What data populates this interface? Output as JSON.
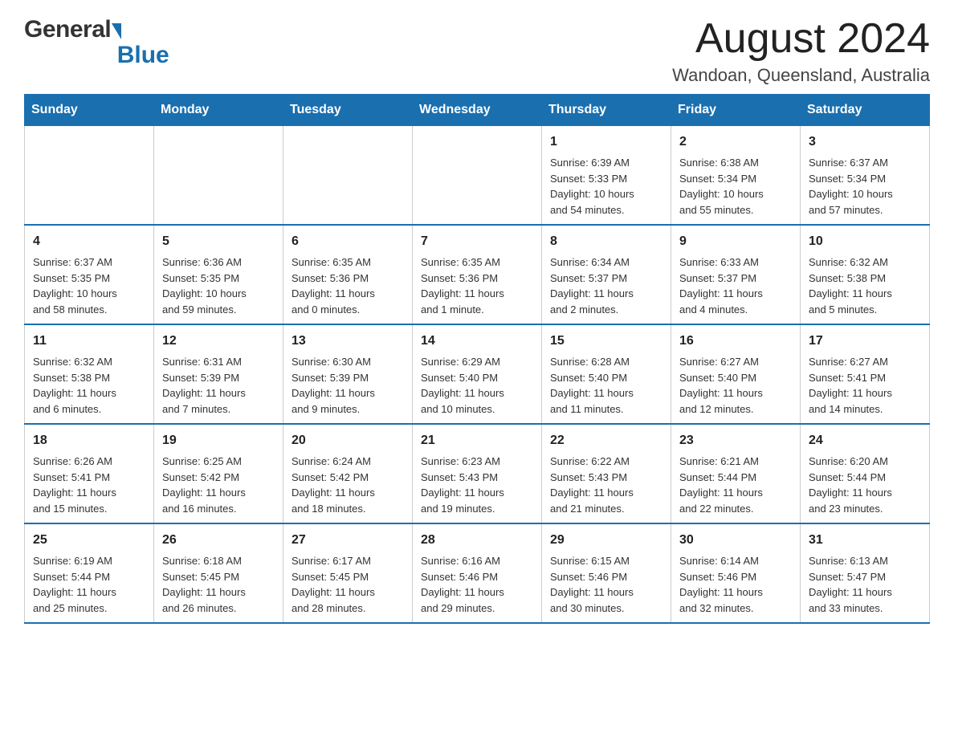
{
  "header": {
    "logo_general": "General",
    "logo_arrow": "▶",
    "logo_blue": "Blue",
    "month_title": "August 2024",
    "location": "Wandoan, Queensland, Australia"
  },
  "days_of_week": [
    "Sunday",
    "Monday",
    "Tuesday",
    "Wednesday",
    "Thursday",
    "Friday",
    "Saturday"
  ],
  "weeks": [
    {
      "days": [
        {
          "number": "",
          "info": ""
        },
        {
          "number": "",
          "info": ""
        },
        {
          "number": "",
          "info": ""
        },
        {
          "number": "",
          "info": ""
        },
        {
          "number": "1",
          "info": "Sunrise: 6:39 AM\nSunset: 5:33 PM\nDaylight: 10 hours\nand 54 minutes."
        },
        {
          "number": "2",
          "info": "Sunrise: 6:38 AM\nSunset: 5:34 PM\nDaylight: 10 hours\nand 55 minutes."
        },
        {
          "number": "3",
          "info": "Sunrise: 6:37 AM\nSunset: 5:34 PM\nDaylight: 10 hours\nand 57 minutes."
        }
      ]
    },
    {
      "days": [
        {
          "number": "4",
          "info": "Sunrise: 6:37 AM\nSunset: 5:35 PM\nDaylight: 10 hours\nand 58 minutes."
        },
        {
          "number": "5",
          "info": "Sunrise: 6:36 AM\nSunset: 5:35 PM\nDaylight: 10 hours\nand 59 minutes."
        },
        {
          "number": "6",
          "info": "Sunrise: 6:35 AM\nSunset: 5:36 PM\nDaylight: 11 hours\nand 0 minutes."
        },
        {
          "number": "7",
          "info": "Sunrise: 6:35 AM\nSunset: 5:36 PM\nDaylight: 11 hours\nand 1 minute."
        },
        {
          "number": "8",
          "info": "Sunrise: 6:34 AM\nSunset: 5:37 PM\nDaylight: 11 hours\nand 2 minutes."
        },
        {
          "number": "9",
          "info": "Sunrise: 6:33 AM\nSunset: 5:37 PM\nDaylight: 11 hours\nand 4 minutes."
        },
        {
          "number": "10",
          "info": "Sunrise: 6:32 AM\nSunset: 5:38 PM\nDaylight: 11 hours\nand 5 minutes."
        }
      ]
    },
    {
      "days": [
        {
          "number": "11",
          "info": "Sunrise: 6:32 AM\nSunset: 5:38 PM\nDaylight: 11 hours\nand 6 minutes."
        },
        {
          "number": "12",
          "info": "Sunrise: 6:31 AM\nSunset: 5:39 PM\nDaylight: 11 hours\nand 7 minutes."
        },
        {
          "number": "13",
          "info": "Sunrise: 6:30 AM\nSunset: 5:39 PM\nDaylight: 11 hours\nand 9 minutes."
        },
        {
          "number": "14",
          "info": "Sunrise: 6:29 AM\nSunset: 5:40 PM\nDaylight: 11 hours\nand 10 minutes."
        },
        {
          "number": "15",
          "info": "Sunrise: 6:28 AM\nSunset: 5:40 PM\nDaylight: 11 hours\nand 11 minutes."
        },
        {
          "number": "16",
          "info": "Sunrise: 6:27 AM\nSunset: 5:40 PM\nDaylight: 11 hours\nand 12 minutes."
        },
        {
          "number": "17",
          "info": "Sunrise: 6:27 AM\nSunset: 5:41 PM\nDaylight: 11 hours\nand 14 minutes."
        }
      ]
    },
    {
      "days": [
        {
          "number": "18",
          "info": "Sunrise: 6:26 AM\nSunset: 5:41 PM\nDaylight: 11 hours\nand 15 minutes."
        },
        {
          "number": "19",
          "info": "Sunrise: 6:25 AM\nSunset: 5:42 PM\nDaylight: 11 hours\nand 16 minutes."
        },
        {
          "number": "20",
          "info": "Sunrise: 6:24 AM\nSunset: 5:42 PM\nDaylight: 11 hours\nand 18 minutes."
        },
        {
          "number": "21",
          "info": "Sunrise: 6:23 AM\nSunset: 5:43 PM\nDaylight: 11 hours\nand 19 minutes."
        },
        {
          "number": "22",
          "info": "Sunrise: 6:22 AM\nSunset: 5:43 PM\nDaylight: 11 hours\nand 21 minutes."
        },
        {
          "number": "23",
          "info": "Sunrise: 6:21 AM\nSunset: 5:44 PM\nDaylight: 11 hours\nand 22 minutes."
        },
        {
          "number": "24",
          "info": "Sunrise: 6:20 AM\nSunset: 5:44 PM\nDaylight: 11 hours\nand 23 minutes."
        }
      ]
    },
    {
      "days": [
        {
          "number": "25",
          "info": "Sunrise: 6:19 AM\nSunset: 5:44 PM\nDaylight: 11 hours\nand 25 minutes."
        },
        {
          "number": "26",
          "info": "Sunrise: 6:18 AM\nSunset: 5:45 PM\nDaylight: 11 hours\nand 26 minutes."
        },
        {
          "number": "27",
          "info": "Sunrise: 6:17 AM\nSunset: 5:45 PM\nDaylight: 11 hours\nand 28 minutes."
        },
        {
          "number": "28",
          "info": "Sunrise: 6:16 AM\nSunset: 5:46 PM\nDaylight: 11 hours\nand 29 minutes."
        },
        {
          "number": "29",
          "info": "Sunrise: 6:15 AM\nSunset: 5:46 PM\nDaylight: 11 hours\nand 30 minutes."
        },
        {
          "number": "30",
          "info": "Sunrise: 6:14 AM\nSunset: 5:46 PM\nDaylight: 11 hours\nand 32 minutes."
        },
        {
          "number": "31",
          "info": "Sunrise: 6:13 AM\nSunset: 5:47 PM\nDaylight: 11 hours\nand 33 minutes."
        }
      ]
    }
  ]
}
